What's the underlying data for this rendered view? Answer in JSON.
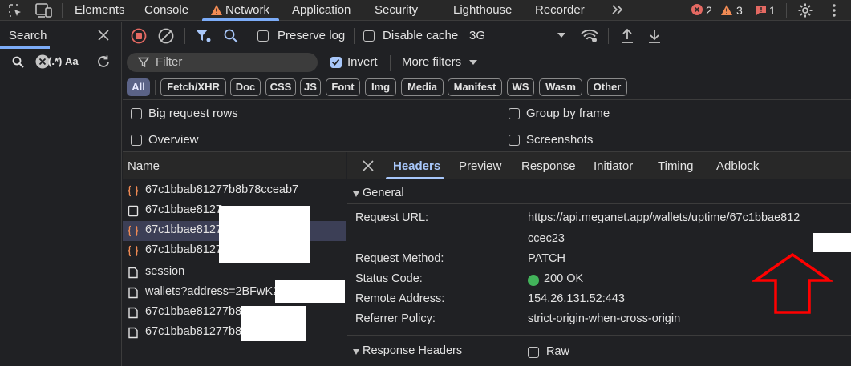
{
  "colors": {
    "accent": "#7cacf8",
    "error": "#e46962",
    "warning": "#f28b54",
    "issue": "#e46962",
    "status_ok": "#42b35a",
    "annotation_arrow": "#ff0000",
    "selected_row": "#3c3f56"
  },
  "top_tabs": [
    "Elements",
    "Console",
    "Network",
    "Application",
    "Security",
    "Lighthouse",
    "Recorder"
  ],
  "more_tabs_icon": "chevron-double-right-icon",
  "counters": {
    "errors": "2",
    "warnings": "3",
    "issues": "1"
  },
  "search_pane": {
    "title": "Search",
    "case_label": "Aa",
    "regex_label": "(.*)"
  },
  "toolbar": {
    "preserve_log": "Preserve log",
    "disable_cache": "Disable cache",
    "throttling": "3G"
  },
  "filter": {
    "placeholder": "Filter",
    "invert": "Invert",
    "more_filters": "More filters"
  },
  "type_filters": [
    "All",
    "Fetch/XHR",
    "Doc",
    "CSS",
    "JS",
    "Font",
    "Img",
    "Media",
    "Manifest",
    "WS",
    "Wasm",
    "Other"
  ],
  "settings": {
    "big_request_rows": "Big request rows",
    "group_by_frame": "Group by frame",
    "overview": "Overview",
    "screenshots": "Screenshots"
  },
  "requests": {
    "column_header": "Name",
    "rows": [
      {
        "name": "67c1bbab81277b8b78cceab7",
        "icon": "fetch-braces-icon"
      },
      {
        "name": "67c1bbae8127",
        "icon": "document-icon"
      },
      {
        "name": "67c1bbae8127",
        "icon": "fetch-braces-icon"
      },
      {
        "name": "67c1bbab8127",
        "icon": "fetch-braces-icon"
      },
      {
        "name": "session",
        "icon": "document-icon"
      },
      {
        "name": "wallets?address=2BFwK2",
        "icon": "document-icon"
      },
      {
        "name": "67c1bbae81277b8",
        "icon": "document-icon"
      },
      {
        "name": "67c1bbab81277b8",
        "icon": "document-icon"
      }
    ]
  },
  "detail_tabs": [
    "Headers",
    "Preview",
    "Response",
    "Initiator",
    "Timing",
    "Adblock"
  ],
  "general": {
    "title": "General",
    "request_url_label": "Request URL:",
    "request_url_line1": "https://api.meganet.app/wallets/uptime/67c1bbae812",
    "request_url_line2": "ccec23",
    "request_method_label": "Request Method:",
    "request_method": "PATCH",
    "status_code_label": "Status Code:",
    "status_code": "200 OK",
    "remote_address_label": "Remote Address:",
    "remote_address": "154.26.131.52:443",
    "referrer_policy_label": "Referrer Policy:",
    "referrer_policy": "strict-origin-when-cross-origin"
  },
  "response_headers": {
    "title": "Response Headers",
    "raw": "Raw"
  }
}
